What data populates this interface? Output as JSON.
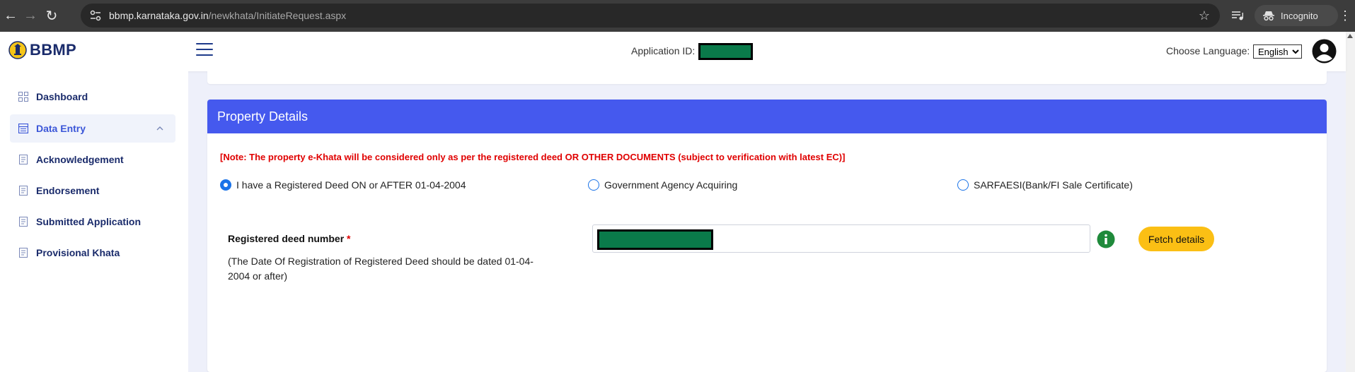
{
  "browser": {
    "url_host": "bbmp.karnataka.gov.in",
    "url_path": "/newkhata/InitiateRequest.aspx",
    "incognito_label": "Incognito",
    "icons": [
      "back-icon",
      "forward-icon",
      "reload-icon",
      "site-info-icon",
      "star-icon",
      "media-icon",
      "incognito-icon",
      "menu-kebab-icon"
    ]
  },
  "header": {
    "brand": "BBMP",
    "application_id_label": "Application ID:",
    "application_id_value": "",
    "choose_language_label": "Choose Language:",
    "language_selected": "English",
    "colors": {
      "brand": "#1a2b6b"
    }
  },
  "sidebar": {
    "items": [
      {
        "label": "Dashboard",
        "icon": "dashboard-grid-icon",
        "active": false
      },
      {
        "label": "Data Entry",
        "icon": "data-entry-icon",
        "active": true,
        "expanded": true
      },
      {
        "label": "Acknowledgement",
        "icon": "document-icon",
        "active": false
      },
      {
        "label": "Endorsement",
        "icon": "document-icon",
        "active": false
      },
      {
        "label": "Submitted Application",
        "icon": "document-icon",
        "active": false
      },
      {
        "label": "Provisional Khata",
        "icon": "document-icon",
        "active": false
      }
    ]
  },
  "property": {
    "title": "Property Details",
    "note": "[Note: The property e-Khata will be considered only as per the registered deed OR OTHER DOCUMENTS (subject to verification with latest EC)]",
    "radio_options": [
      {
        "label": "I have a Registered Deed ON or AFTER 01-04-2004",
        "checked": true
      },
      {
        "label": "Government Agency Acquiring",
        "checked": false
      },
      {
        "label": "SARFAESI(Bank/FI Sale Certificate)",
        "checked": false
      }
    ],
    "deed_label": "Registered deed number",
    "required_mark": "*",
    "deed_help": "(The Date Of Registration of Registered Deed should be dated 01-04-2004 or after)",
    "deed_value": "",
    "fetch_button": "Fetch details",
    "colors": {
      "header_bg": "#4559ee",
      "note": "#e00000",
      "button": "#fbbf14",
      "info": "#1f8a3b"
    }
  }
}
